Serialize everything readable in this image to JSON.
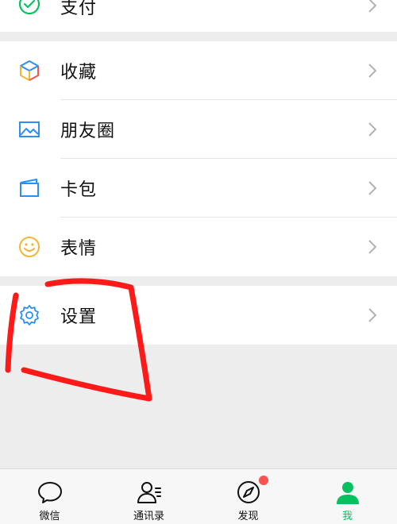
{
  "menu": {
    "top_partial": {
      "label": "支付",
      "icon": "wechat-pay-icon"
    },
    "items": [
      {
        "label": "收藏",
        "icon": "favorites-cube-icon"
      },
      {
        "label": "朋友圈",
        "icon": "moments-photo-icon"
      },
      {
        "label": "卡包",
        "icon": "card-wallet-icon"
      },
      {
        "label": "表情",
        "icon": "smiley-face-icon"
      }
    ],
    "settings": {
      "label": "设置",
      "icon": "gear-icon"
    }
  },
  "tabbar": {
    "tabs": [
      {
        "label": "微信",
        "icon": "chat-bubble-icon",
        "active": false
      },
      {
        "label": "通讯录",
        "icon": "contacts-icon",
        "active": false
      },
      {
        "label": "发现",
        "icon": "compass-icon",
        "active": false,
        "badge": true
      },
      {
        "label": "我",
        "icon": "person-icon",
        "active": true
      }
    ]
  },
  "colors": {
    "accent_green": "#07c160",
    "badge_red": "#fa5151",
    "icon_blue": "#2c8ff2",
    "annotation_red": "#ff1a1a",
    "background": "#ededed"
  }
}
